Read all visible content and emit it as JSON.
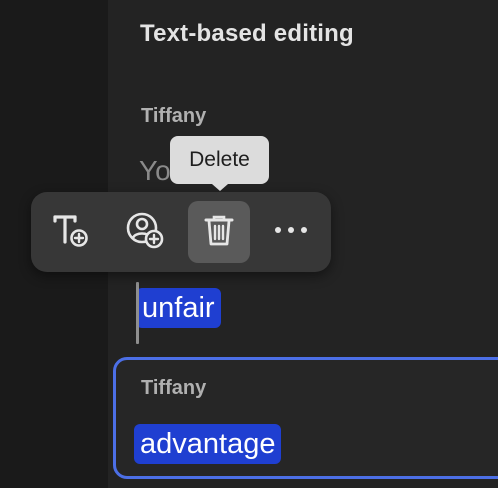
{
  "panel": {
    "title": "Text-based editing"
  },
  "transcript": {
    "segment_1": {
      "speaker": "Tiffany",
      "visible_fragment": "Yo",
      "selected_word": "unfair"
    },
    "segment_2": {
      "speaker": "Tiffany",
      "selected_word": "advantage"
    }
  },
  "toolbar": {
    "tooltip": "Delete",
    "buttons": [
      {
        "icon": "add-text-icon",
        "active": false
      },
      {
        "icon": "add-speaker-icon",
        "active": false
      },
      {
        "icon": "trash-icon",
        "active": true
      },
      {
        "icon": "more-icon",
        "active": false
      }
    ]
  },
  "colors": {
    "selection": "#1f3fd1",
    "focus_border": "#4c6fe6",
    "panel_bg": "#232323",
    "toolbar_bg": "#373737"
  }
}
